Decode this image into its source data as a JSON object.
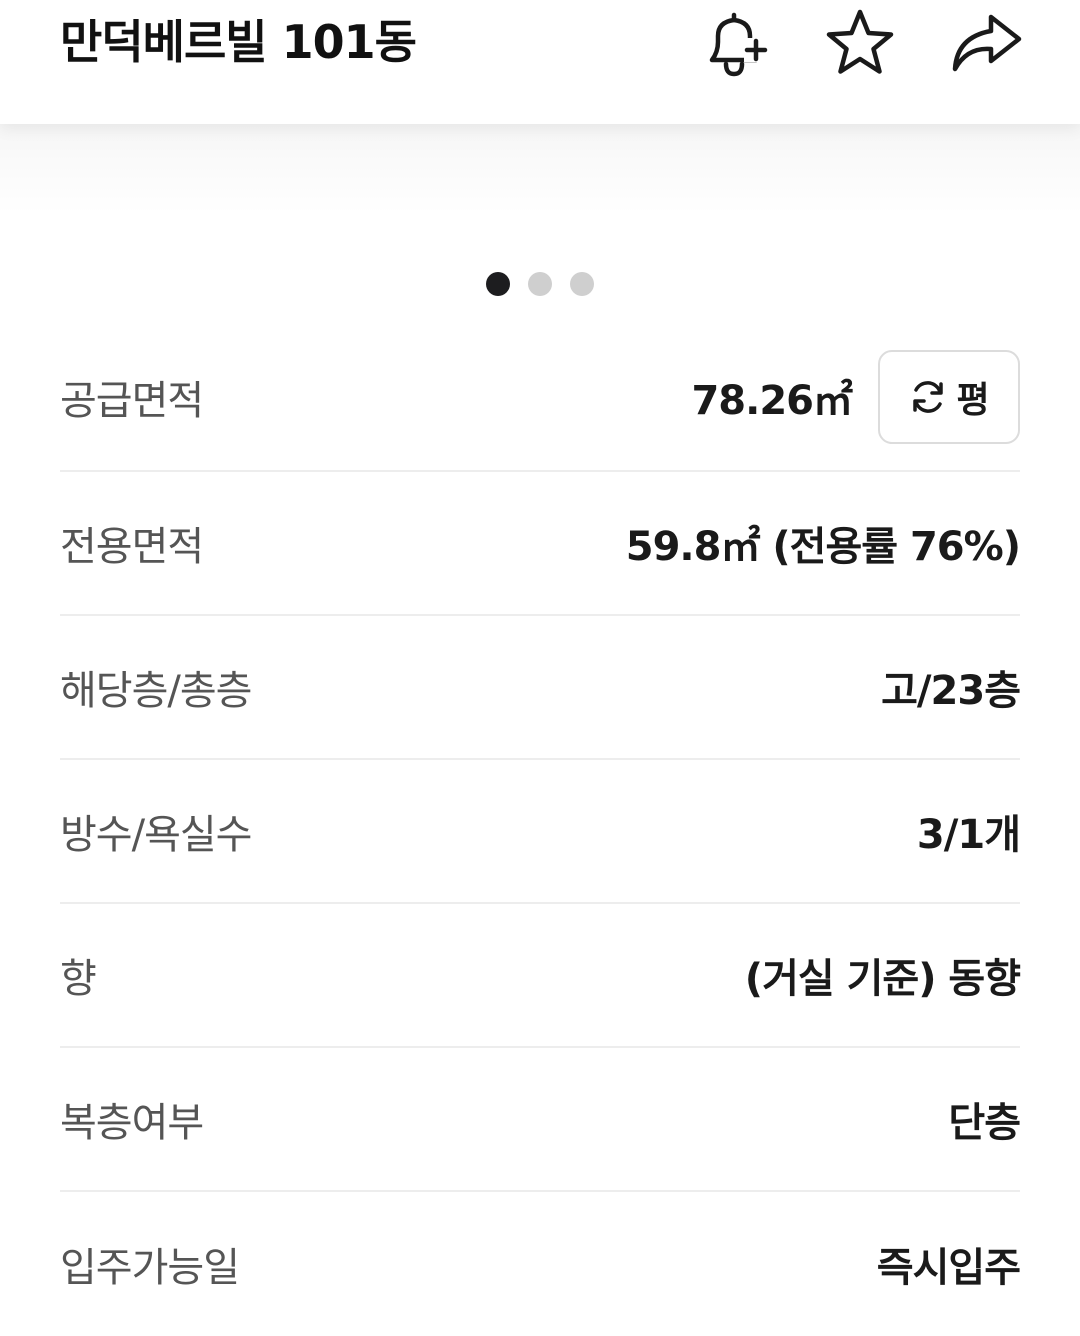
{
  "header": {
    "title": "만덕베르빌 101동",
    "icons": [
      "bell-plus-icon",
      "star-icon",
      "share-icon"
    ]
  },
  "gallery": {
    "dot_count": 3,
    "active_index": 0
  },
  "details": {
    "supply_area": {
      "label": "공급면적",
      "value": "78.26㎡",
      "unit_toggle_label": "평"
    },
    "exclusive_area": {
      "label": "전용면적",
      "value": "59.8㎡ (전용률 76%)"
    },
    "floor": {
      "label": "해당층/총층",
      "value": "고/23층"
    },
    "rooms": {
      "label": "방수/욕실수",
      "value": "3/1개"
    },
    "direction": {
      "label": "향",
      "value": "(거실 기준) 동향"
    },
    "duplex": {
      "label": "복층여부",
      "value": "단층"
    },
    "move_in": {
      "label": "입주가능일",
      "value": "즉시입주"
    }
  },
  "colors": {
    "text_primary": "#1a1a1a",
    "text_label": "#555555",
    "divider": "#ededed",
    "dot_active": "#1d1d1f",
    "dot_inactive": "#cfcfcf"
  }
}
